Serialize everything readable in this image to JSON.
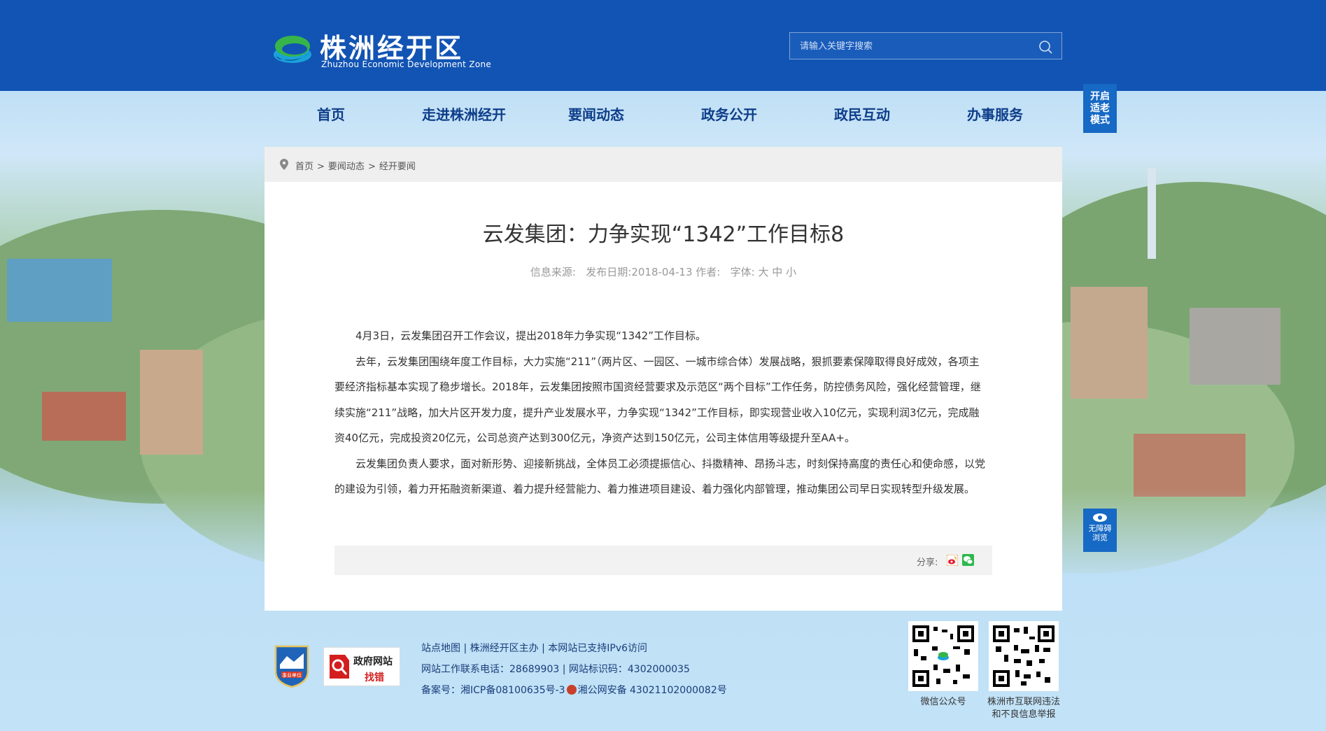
{
  "header": {
    "title": "株洲经开区",
    "subtitle": "Zhuzhou Economic Development Zone",
    "search_placeholder": "请输入关键字搜索"
  },
  "nav": {
    "items": [
      {
        "label": "首页"
      },
      {
        "label": "走进株洲经开"
      },
      {
        "label": "要闻动态"
      },
      {
        "label": "政务公开"
      },
      {
        "label": "政民互动"
      },
      {
        "label": "办事服务"
      }
    ]
  },
  "side_buttons": {
    "elder_mode": [
      "开启",
      "适老",
      "模式"
    ],
    "accessibility": [
      "无障碍",
      "浏览"
    ]
  },
  "breadcrumb": [
    "首页",
    "要闻动态",
    "经开要闻"
  ],
  "breadcrumb_separator": ">",
  "article": {
    "title": "云发集团：力争实现“1342”工作目标8",
    "meta": {
      "source_label": "信息来源:",
      "date_label": "发布日期:",
      "date": "2018-04-13",
      "author_label": "作者:",
      "font_label": "字体:",
      "font_sizes": [
        "大",
        "中",
        "小"
      ]
    },
    "paragraphs": [
      "4月3日，云发集团召开工作会议，提出2018年力争实现“1342”工作目标。",
      "去年，云发集团围绕年度工作目标，大力实施“211”（两片区、一园区、一城市综合体）发展战略，狠抓要素保障取得良好成效，各项主要经济指标基本实现了稳步增长。2018年，云发集团按照市国资经营要求及示范区“两个目标”工作任务，防控债务风险，强化经营管理，继续实施“211”战略，加大片区开发力度，提升产业发展水平，力争实现“1342”工作目标，即实现营业收入10亿元，实现利润3亿元，完成融资40亿元，完成投资20亿元，公司总资产达到300亿元，净资产达到150亿元，公司主体信用等级提升至AA+。",
      "云发集团负责人要求，面对新形势、迎接新挑战，全体员工必须提振信心、抖擞精神、昂扬斗志，时刻保持高度的责任心和使命感，以党的建设为引领，着力开拓融资新渠道、着力提升经营能力、着力推进项目建设、着力强化内部管理，推动集团公司早日实现转型升级发展。"
    ],
    "share_label": "分享:"
  },
  "footer": {
    "badge1_label": "事业单位",
    "badge2_title": "政府网站",
    "badge2_sub": "找错",
    "links": [
      "站点地图",
      "株洲经开区主办",
      "本网站已支持IPv6访问"
    ],
    "phone_label": "网站工作联系电话：",
    "phone": "28689903",
    "site_id_label": "网站标识码：",
    "site_id": "4302000035",
    "icp_label": "备案号：",
    "icp": "湘ICP备08100635号-3",
    "police": "湘公网安备 43021102000082号",
    "qr1_caption": "微信公众号",
    "qr2_caption": [
      "株洲市互联网违法",
      "和不良信息举报"
    ]
  },
  "colors": {
    "header_bg": "#1254b4",
    "nav_text": "#0e3e8a",
    "side_button_bg": "#1669c4"
  }
}
